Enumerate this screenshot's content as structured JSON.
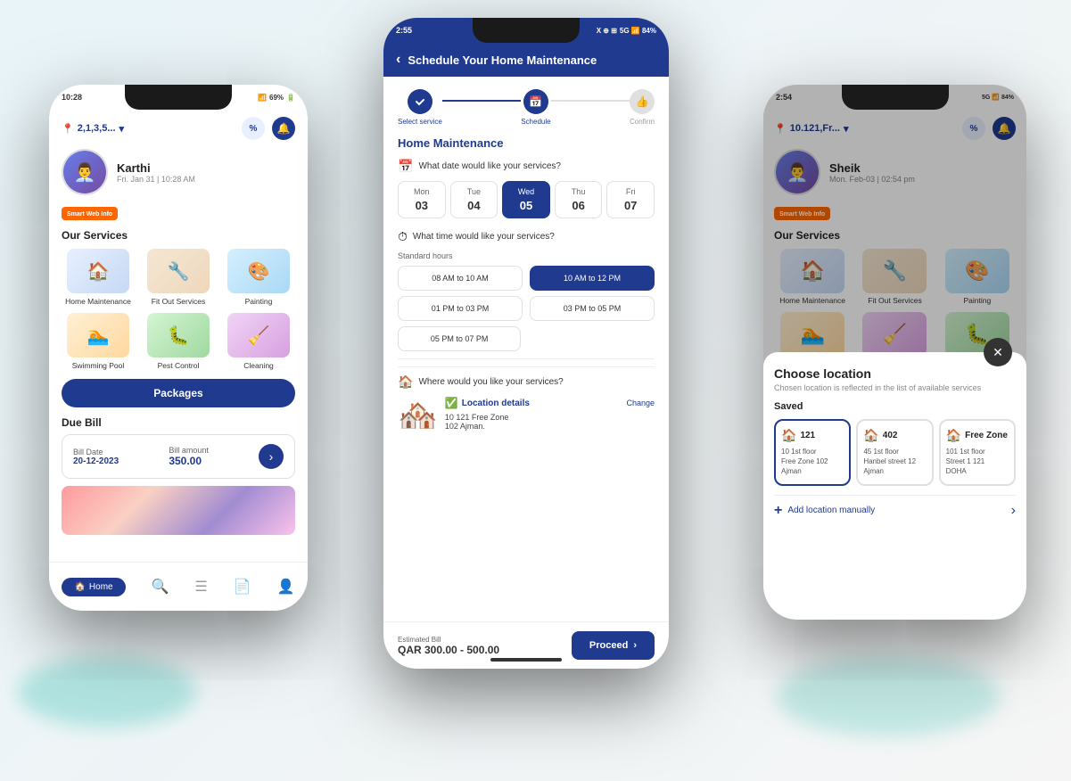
{
  "phone_left": {
    "status_time": "10:28",
    "status_icons": "▲▼ 69%",
    "location": "2,1,3,5...",
    "user_name": "Karthi",
    "user_datetime": "Fri. Jan 31 | 10:28 AM",
    "brand": "Smart Web Info",
    "services_title": "Our Services",
    "services": [
      {
        "label": "Home Maintenance",
        "icon": "🏠",
        "color": "st-maintenance"
      },
      {
        "label": "Fit Out Services",
        "icon": "🔧",
        "color": "st-fitout"
      },
      {
        "label": "Painting",
        "icon": "🎨",
        "color": "st-painting"
      },
      {
        "label": "Swimming Pool",
        "icon": "🏊",
        "color": "st-pool"
      },
      {
        "label": "Pest Control",
        "icon": "🐛",
        "color": "st-pest"
      },
      {
        "label": "Cleaning",
        "icon": "🧹",
        "color": "st-cleaning"
      }
    ],
    "packages_label": "Packages",
    "due_bill_title": "Due Bill",
    "bill_date_label": "Bill Date",
    "bill_date": "20-12-2023",
    "bill_amount_label": "Bill amount",
    "bill_amount": "350.00",
    "nav_home": "Home",
    "nav_search": "Search",
    "nav_list": "List",
    "nav_docs": "Docs",
    "nav_profile": "Profile"
  },
  "phone_center": {
    "status_time": "2:55",
    "header_title": "Schedule Your Home Maintenance",
    "step1_label": "Select service",
    "step2_label": "Schedule",
    "step3_label": "Confirm",
    "section_title": "Home Maintenance",
    "date_question": "What date would like your services?",
    "days": [
      {
        "name": "Mon",
        "num": "03",
        "selected": false
      },
      {
        "name": "Tue",
        "num": "04",
        "selected": false
      },
      {
        "name": "Wed",
        "num": "05",
        "selected": true
      },
      {
        "name": "Thu",
        "num": "06",
        "selected": false
      },
      {
        "name": "Fri",
        "num": "07",
        "selected": false
      }
    ],
    "time_question": "What time would like your services?",
    "standard_hours_label": "Standard hours",
    "time_slots": [
      {
        "label": "08 AM to 10 AM",
        "selected": false
      },
      {
        "label": "10 AM to 12 PM",
        "selected": true
      },
      {
        "label": "01 PM to 03 PM",
        "selected": false
      },
      {
        "label": "03 PM to 05 PM",
        "selected": false
      },
      {
        "label": "05 PM to 07 PM",
        "selected": false
      }
    ],
    "where_question": "Where would you like your services?",
    "location_details_label": "Location details",
    "location_line1": "10  121  Free  Zone",
    "location_line2": "102  Ajman.",
    "change_label": "Change",
    "estimated_label": "Estimated Bill",
    "estimated_amount": "QAR 300.00 - 500.00",
    "proceed_label": "Proceed"
  },
  "phone_right": {
    "status_time": "2:54",
    "location": "10.121,Fr...",
    "user_name": "Sheik",
    "user_datetime": "Mon. Feb-03 | 02:54 pm",
    "brand": "Smart Web Info",
    "services_title": "Our Services",
    "services": [
      {
        "label": "Home Maintenance",
        "icon": "🏠",
        "color": "st-maintenance"
      },
      {
        "label": "Fit Out Services",
        "icon": "🔧",
        "color": "st-fitout"
      },
      {
        "label": "Painting",
        "icon": "🎨",
        "color": "st-painting"
      }
    ],
    "modal_title": "Choose location",
    "modal_subtitle": "Chosen location is reflected in the list of available services",
    "saved_label": "Saved",
    "locations": [
      {
        "id": "121",
        "floor": "10  1st floor",
        "area": "Free Zone  102",
        "city": "Ajman"
      },
      {
        "id": "402",
        "floor": "45  1st floor",
        "area": "Hanbel street  12",
        "city": "Ajman"
      },
      {
        "id": "Free Zone",
        "floor": "101  1st floor",
        "area": "Street 1  121",
        "city": "DOHA"
      }
    ],
    "add_location_label": "Add location manually"
  }
}
